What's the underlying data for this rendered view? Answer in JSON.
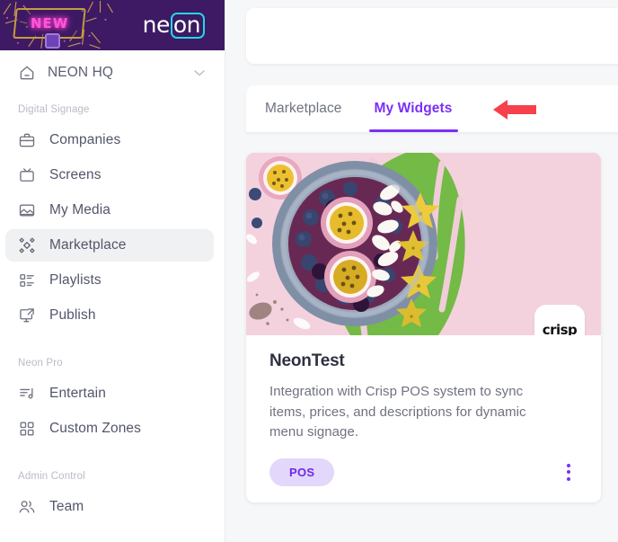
{
  "sidebar": {
    "banner": {
      "badge_text": "NEW",
      "logo_left": "ne",
      "logo_right": "on",
      "bg_color": "#3d1a63",
      "accent_color": "#22d7e8"
    },
    "org": {
      "label": "NEON HQ",
      "icon": "home-icon",
      "chevron": "chevron-down-icon"
    },
    "sections": [
      {
        "title": "Digital Signage",
        "items": [
          {
            "label": "Companies",
            "icon": "briefcase-icon",
            "active": false
          },
          {
            "label": "Screens",
            "icon": "tv-icon",
            "active": false
          },
          {
            "label": "My Media",
            "icon": "image-icon",
            "active": false
          },
          {
            "label": "Marketplace",
            "icon": "diamonds-icon",
            "active": true
          },
          {
            "label": "Playlists",
            "icon": "list-layout-icon",
            "active": false
          },
          {
            "label": "Publish",
            "icon": "monitor-share-icon",
            "active": false
          }
        ]
      },
      {
        "title": "Neon Pro",
        "items": [
          {
            "label": "Entertain",
            "icon": "music-list-icon",
            "active": false
          },
          {
            "label": "Custom Zones",
            "icon": "grid-icon",
            "active": false
          }
        ]
      },
      {
        "title": "Admin Control",
        "items": [
          {
            "label": "Team",
            "icon": "users-icon",
            "active": false
          }
        ]
      }
    ]
  },
  "main": {
    "tabs": [
      {
        "label": "Marketplace",
        "active": false
      },
      {
        "label": "My Widgets",
        "active": true
      }
    ],
    "active_tab_color": "#7b2ff7",
    "annotation": {
      "type": "arrow-left",
      "color": "#f6414c"
    },
    "widget": {
      "title": "NeonTest",
      "description": "Integration with Crisp POS system to sync items, prices, and descriptions for dynamic menu signage.",
      "tag": "POS",
      "tag_bg": "#e3d7fb",
      "tag_color": "#6d28e8",
      "logo_text": "crisp",
      "menu_icon": "kebab-menu-icon",
      "hero_alt": "acai-bowl-photo"
    }
  }
}
